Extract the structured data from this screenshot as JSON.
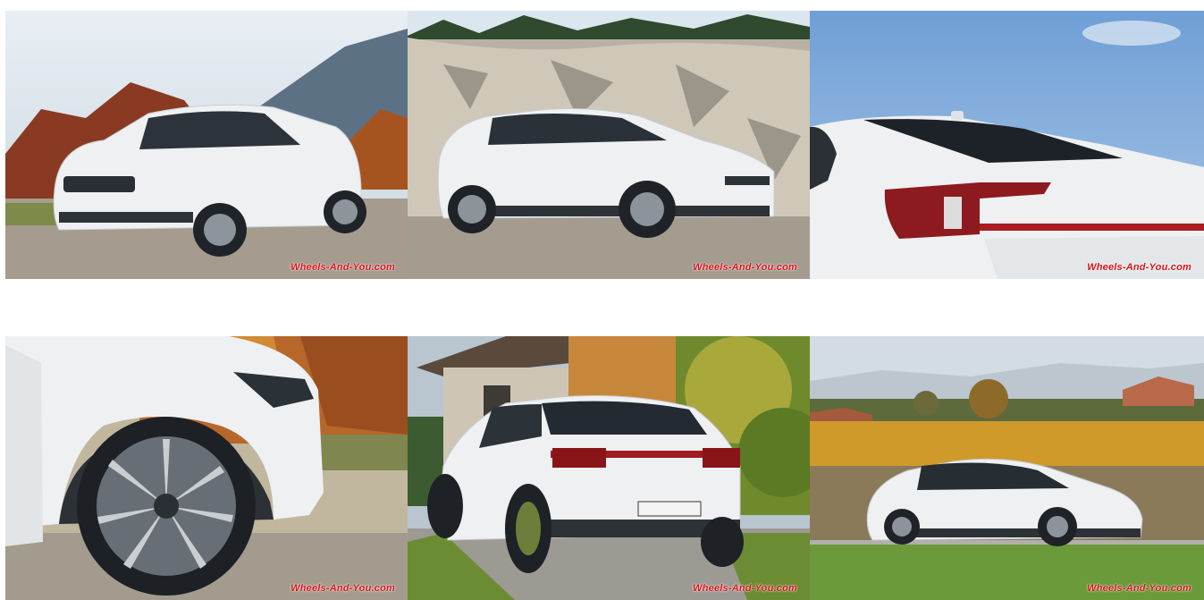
{
  "watermark": "Wheels-And-You.com",
  "photos": [
    {
      "subject": "car-front-three-quarter",
      "alt": "white car front three-quarter view"
    },
    {
      "subject": "car-side-rock-wall",
      "alt": "white car side view near rock wall"
    },
    {
      "subject": "car-taillight-detail",
      "alt": "white car rear taillight detail"
    },
    {
      "subject": "car-wheel-detail",
      "alt": "white car front wheel detail"
    },
    {
      "subject": "car-rear-view",
      "alt": "white car rear view near house"
    },
    {
      "subject": "car-vineyard-side",
      "alt": "white car side view by vineyard"
    }
  ],
  "colors": {
    "watermark": "#d8141a",
    "car_body": "#eef0f2",
    "sky": "#8fb6e0",
    "foliage": "#c0702a"
  }
}
